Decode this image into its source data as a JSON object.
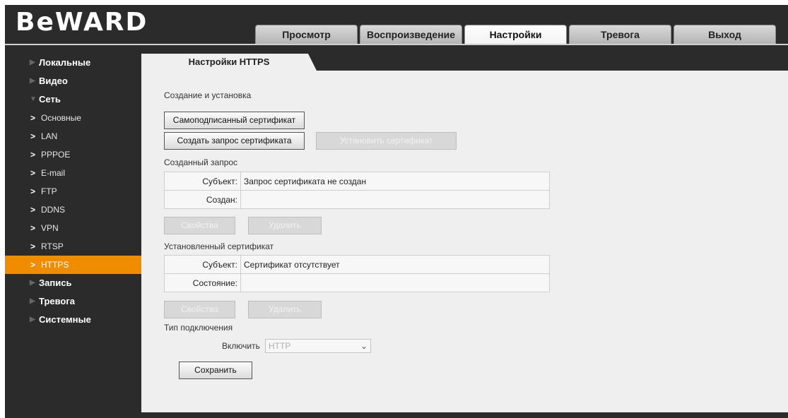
{
  "app": {
    "logo": "BeWARD"
  },
  "tabs": [
    {
      "label": "Просмотр"
    },
    {
      "label": "Воспроизведение"
    },
    {
      "label": "Настройки",
      "active": true
    },
    {
      "label": "Тревога"
    },
    {
      "label": "Выход"
    }
  ],
  "sidebar": {
    "sections": [
      {
        "label": "Локальные"
      },
      {
        "label": "Видео"
      },
      {
        "label": "Сеть"
      }
    ],
    "network_items": [
      {
        "label": "Основные"
      },
      {
        "label": "LAN"
      },
      {
        "label": "PPPOE"
      },
      {
        "label": "E-mail"
      },
      {
        "label": "FTP"
      },
      {
        "label": "DDNS"
      },
      {
        "label": "VPN"
      },
      {
        "label": "RTSP"
      },
      {
        "label": "HTTPS",
        "active": true
      }
    ],
    "after": [
      {
        "label": "Запись"
      },
      {
        "label": "Тревога"
      },
      {
        "label": "Системные"
      }
    ]
  },
  "content_tab": "Настройки HTTPS",
  "create": {
    "section_label": "Создание и установка",
    "self_signed_button": "Самоподписанный сертификат",
    "create_request_button": "Создать запрос сертификата",
    "install_cert_button": "Установить сертификат"
  },
  "request": {
    "section_label": "Созданный запрос",
    "subject_key": "Субъект:",
    "subject_value": "Запрос сертификата не создан",
    "created_key": "Создан:",
    "created_value": "",
    "properties_button": "Свойства",
    "delete_button": "Удалить"
  },
  "installed": {
    "section_label": "Установленный сертификат",
    "subject_key": "Субъект:",
    "subject_value": "Сертификат отсутствует",
    "state_key": "Состояние:",
    "state_value": "",
    "properties_button": "Свойства",
    "delete_button": "Удалить"
  },
  "connection": {
    "section_label": "Тип подключения",
    "enable_label": "Включить",
    "enable_value": "HTTP"
  },
  "save_button": "Сохранить",
  "colors": {
    "accent": "#f08c00",
    "background": "#2b2b2b",
    "panel": "#efefef"
  }
}
